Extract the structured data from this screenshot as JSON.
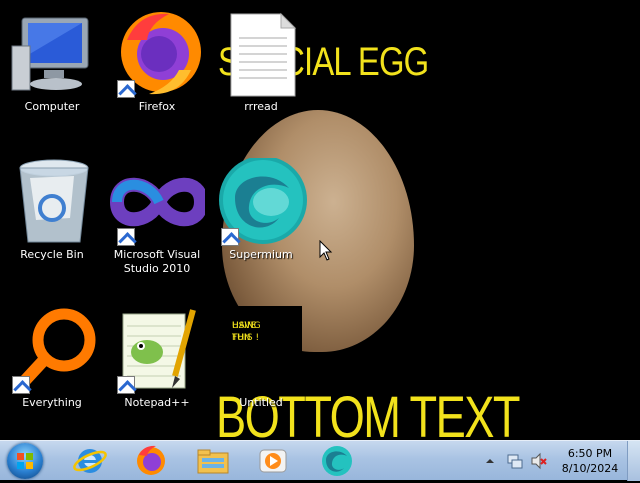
{
  "wallpaper": {
    "top_text": "SPECIAL EGG",
    "bottom_text": "BOTTOM TEXT",
    "note_line1": "HAVE FUN",
    "note_line2": "USING THIS !",
    "text_color": "#f2e21c"
  },
  "desktop_icons": [
    {
      "label": "Computer",
      "icon": "computer-icon"
    },
    {
      "label": "Firefox",
      "icon": "firefox-icon",
      "shortcut": true
    },
    {
      "label": "rrread",
      "icon": "text-file-icon"
    },
    {
      "label": "Recycle Bin",
      "icon": "recycle-bin-icon"
    },
    {
      "label": "Microsoft Visual Studio 2010",
      "line1": "Microsoft Visual",
      "line2": "Studio 2010",
      "icon": "visual-studio-icon",
      "shortcut": true
    },
    {
      "label": "Supermium",
      "icon": "supermium-icon",
      "shortcut": true
    },
    {
      "label": "Everything",
      "icon": "everything-search-icon",
      "shortcut": true
    },
    {
      "label": "Notepad++",
      "icon": "notepad-plus-plus-icon",
      "shortcut": true
    },
    {
      "label": "Untitled",
      "icon": "untitled-file-icon"
    }
  ],
  "taskbar": {
    "pinned": [
      "internet-explorer-icon",
      "firefox-icon",
      "file-explorer-icon",
      "media-player-icon",
      "supermium-icon"
    ],
    "tray": {
      "time": "6:50 PM",
      "date": "8/10/2024",
      "icons": [
        "show-hidden-icons-chevron",
        "network-icon",
        "volume-muted-icon"
      ]
    }
  },
  "colors": {
    "taskbar": "#a9c3e3",
    "desktop_bg": "#000000"
  }
}
